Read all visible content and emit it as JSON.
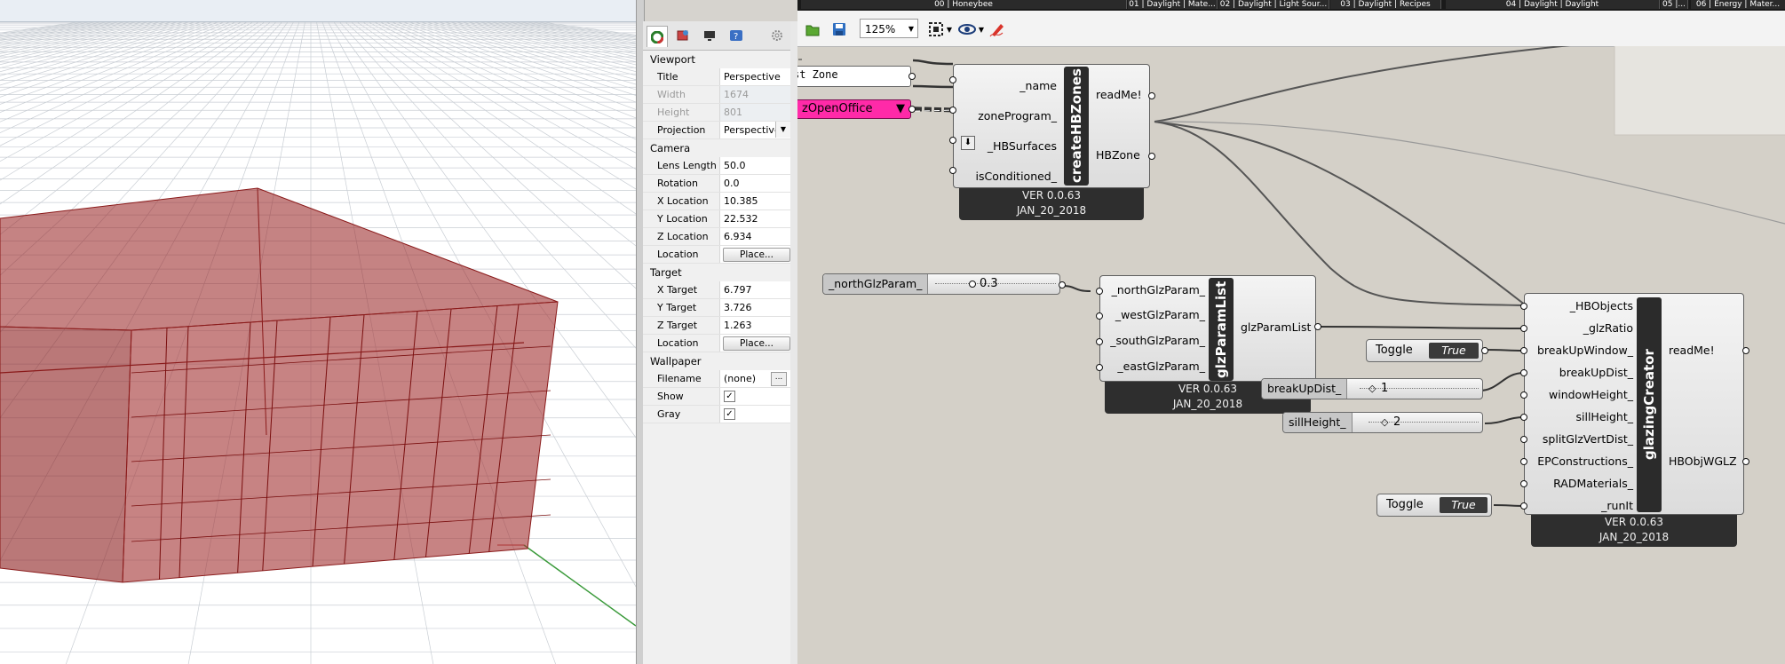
{
  "properties": {
    "sections": {
      "viewport": "Viewport",
      "camera": "Camera",
      "target": "Target",
      "wallpaper": "Wallpaper"
    },
    "viewport_rows": [
      {
        "label": "Title",
        "value": "Perspective"
      },
      {
        "label": "Width",
        "value": "1674"
      },
      {
        "label": "Height",
        "value": "801"
      },
      {
        "label": "Projection",
        "value": "Perspective"
      }
    ],
    "camera_rows": [
      {
        "label": "Lens Length",
        "value": "50.0"
      },
      {
        "label": "Rotation",
        "value": "0.0"
      },
      {
        "label": "X Location",
        "value": "10.385"
      },
      {
        "label": "Y Location",
        "value": "22.532"
      },
      {
        "label": "Z Location",
        "value": "6.934"
      },
      {
        "label": "Location",
        "value": "Place..."
      }
    ],
    "target_rows": [
      {
        "label": "X Target",
        "value": "6.797"
      },
      {
        "label": "Y Target",
        "value": "3.726"
      },
      {
        "label": "Z Target",
        "value": "1.263"
      },
      {
        "label": "Location",
        "value": "Place..."
      }
    ],
    "wallpaper_rows": [
      {
        "label": "Filename",
        "value": "(none)",
        "button": "..."
      },
      {
        "label": "Show",
        "value": "✓"
      },
      {
        "label": "Gray",
        "value": "✓"
      }
    ]
  },
  "grasshopper": {
    "tabs": [
      "00 | Honeybee",
      "01 | Daylight | Mate...",
      "02 | Daylight | Light Sour...",
      "03 | Daylight | Recipes",
      "04 | Daylight | Daylight",
      "05 |...",
      "06 | Energy | Mater..."
    ],
    "zoom": "125%",
    "panel_text": "st Zone",
    "value_list": "zOpenOffice",
    "createHBZones": {
      "title": "createHBZones",
      "inputs": [
        "_name",
        "zoneProgram_",
        "_HBSurfaces",
        "isConditioned_"
      ],
      "outputs": [
        "readMe!",
        "HBZone"
      ],
      "version": "VER 0.0.63",
      "date": "JAN_20_2018"
    },
    "glzParamList": {
      "title": "glzParamList",
      "inputs": [
        "_northGlzParam_",
        "_westGlzParam_",
        "_southGlzParam_",
        "_eastGlzParam_"
      ],
      "outputs": [
        "glzParamList"
      ],
      "version": "VER 0.0.63",
      "date": "JAN_20_2018"
    },
    "glazingCreator": {
      "title": "glazingCreator",
      "inputs": [
        "_HBObjects",
        "_glzRatio",
        "breakUpWindow_",
        "breakUpDist_",
        "windowHeight_",
        "sillHeight_",
        "splitGlzVertDist_",
        "EPConstructions_",
        "RADMaterials_",
        "_runIt"
      ],
      "outputs": [
        "readMe!",
        "HBObjWGLZ"
      ],
      "version": "VER 0.0.63",
      "date": "JAN_20_2018"
    },
    "sliders": {
      "north": {
        "name": "_northGlzParam_",
        "value": "0.3"
      },
      "breakUp": {
        "name": "breakUpDist_",
        "value": "1"
      },
      "sill": {
        "name": "sillHeight_",
        "value": "2"
      }
    },
    "toggles": {
      "breakUpWindow": {
        "label": "Toggle",
        "value": "True"
      },
      "runIt": {
        "label": "Toggle",
        "value": "True"
      }
    }
  }
}
